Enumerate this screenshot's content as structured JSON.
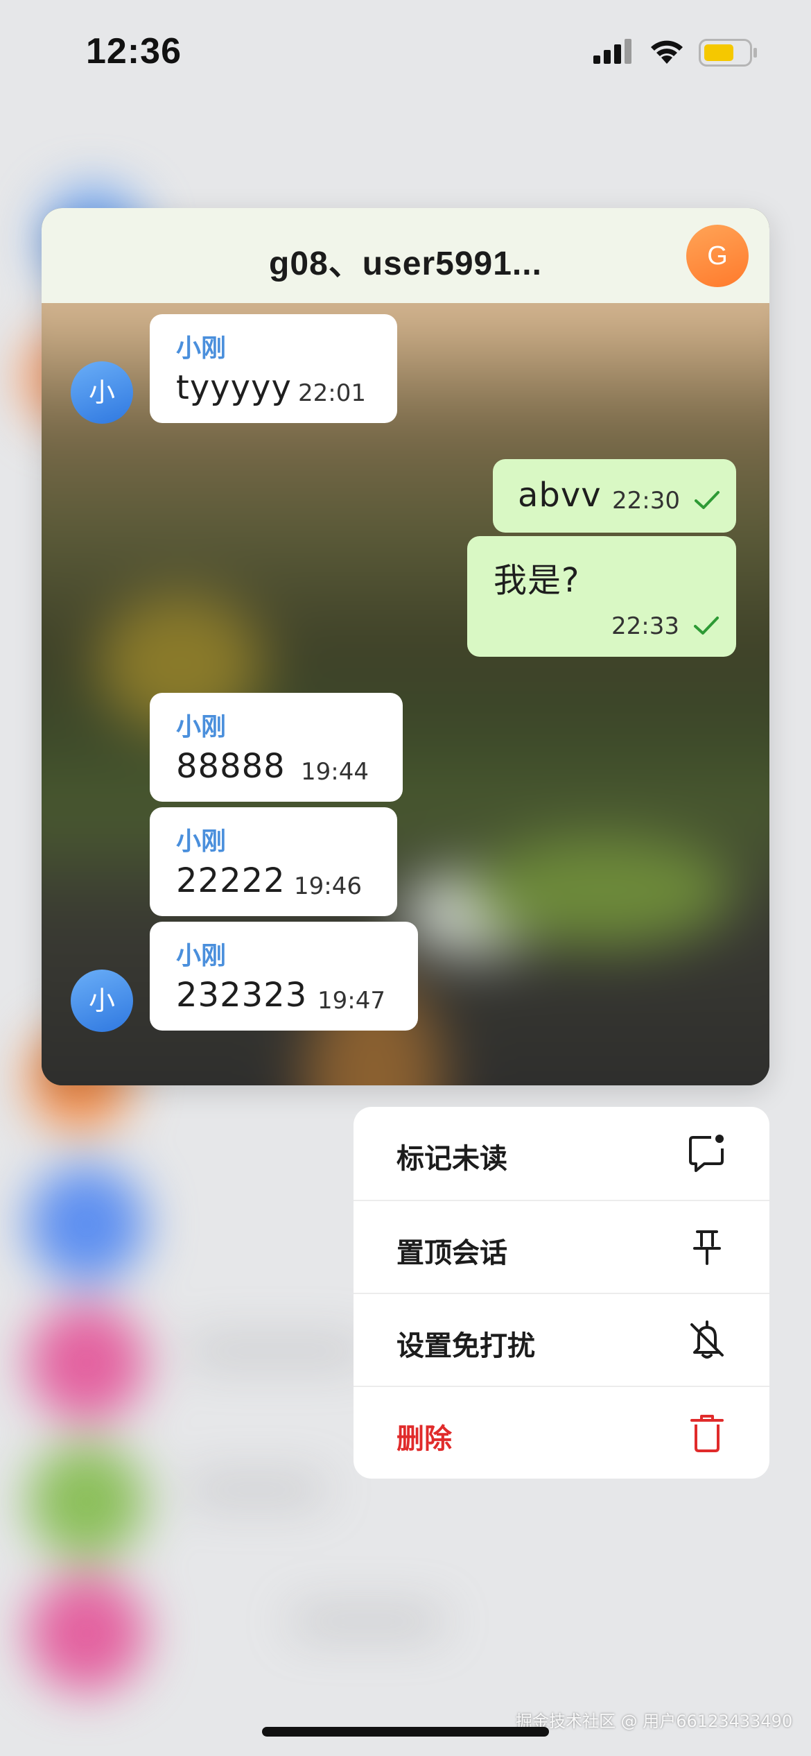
{
  "status_bar": {
    "time": "12:36"
  },
  "chat_preview": {
    "title": "g08、user5991...",
    "header_avatar_letter": "G",
    "messages": [
      {
        "direction": "incoming",
        "sender": "小刚",
        "text": "tyyyyy",
        "time": "22:01",
        "avatar": "小"
      },
      {
        "direction": "outgoing",
        "text": "abvv",
        "time": "22:30",
        "status_icon": "check-icon"
      },
      {
        "direction": "outgoing",
        "text": "我是?",
        "time": "22:33",
        "status_icon": "check-icon"
      },
      {
        "direction": "incoming",
        "sender": "小刚",
        "text": "88888",
        "time": "19:44"
      },
      {
        "direction": "incoming",
        "sender": "小刚",
        "text": "22222",
        "time": "19:46"
      },
      {
        "direction": "incoming",
        "sender": "小刚",
        "text": "232323",
        "time": "19:47",
        "avatar": "小"
      }
    ]
  },
  "context_menu": {
    "items": [
      {
        "label": "标记未读",
        "icon": "mark-unread-icon"
      },
      {
        "label": "置顶会话",
        "icon": "pin-icon"
      },
      {
        "label": "设置免打扰",
        "icon": "bell-off-icon"
      },
      {
        "label": "删除",
        "icon": "trash-icon",
        "danger": true
      }
    ]
  },
  "footer": {
    "watermark": "掘金技术社区 @ 用户66123433490"
  },
  "colors": {
    "accent_blue": "#4a8fdc",
    "outgoing_bubble": "#d9f8c4",
    "danger_red": "#e02b2b",
    "header_avatar": "#ff8a3d"
  }
}
